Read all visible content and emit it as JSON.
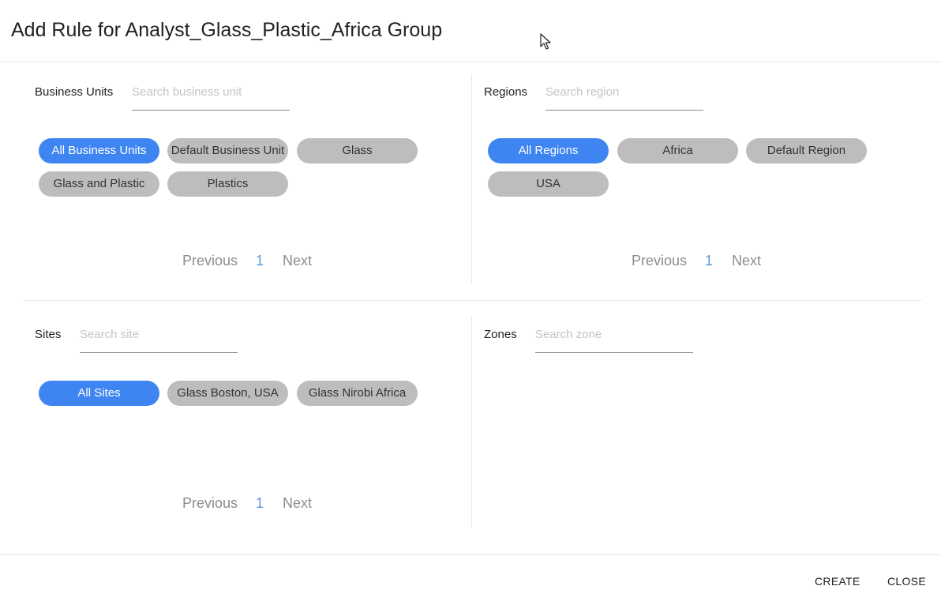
{
  "dialog": {
    "title": "Add Rule for Analyst_Glass_Plastic_Africa Group"
  },
  "business_units": {
    "label": "Business Units",
    "search_placeholder": "Search business unit",
    "chips": [
      "All Business Units",
      "Default Business Unit",
      "Glass",
      "Glass and Plastic",
      "Plastics"
    ],
    "selected": "All Business Units",
    "pager": {
      "previous": "Previous",
      "page": "1",
      "next": "Next"
    }
  },
  "regions": {
    "label": "Regions",
    "search_placeholder": "Search region",
    "chips": [
      "All Regions",
      "Africa",
      "Default Region",
      "USA"
    ],
    "selected": "All Regions",
    "pager": {
      "previous": "Previous",
      "page": "1",
      "next": "Next"
    }
  },
  "sites": {
    "label": "Sites",
    "search_placeholder": "Search site",
    "chips": [
      "All Sites",
      "Glass Boston, USA",
      "Glass Nirobi Africa"
    ],
    "selected": "All Sites",
    "pager": {
      "previous": "Previous",
      "page": "1",
      "next": "Next"
    }
  },
  "zones": {
    "label": "Zones",
    "search_placeholder": "Search zone"
  },
  "footer": {
    "create_label": "CREATE",
    "close_label": "CLOSE"
  },
  "colors": {
    "accent": "#3f85f2",
    "chip": "#bdbdbd",
    "page_number": "#5b95e8"
  }
}
